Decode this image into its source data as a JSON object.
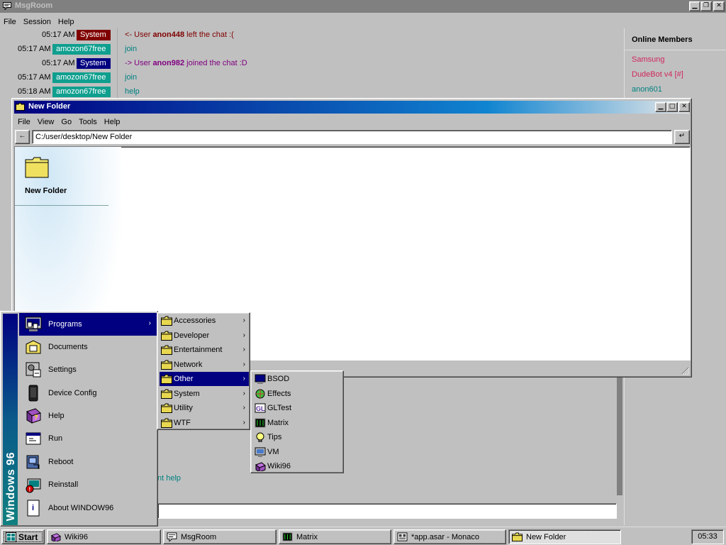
{
  "colors": {
    "accent": "#000080",
    "system_badge_red": "#800000",
    "system_badge_navy": "#000080",
    "user_badge": "#0f9f8f",
    "chat_text_teal": "#008080",
    "leave_text": "#800000",
    "join_text": "#800080"
  },
  "msgroom": {
    "title": "MsgRoom",
    "menu": [
      "File",
      "Session",
      "Help"
    ],
    "messages": [
      {
        "time": "05:17 AM",
        "user": "System",
        "badge_color": "#800000",
        "text_prefix": "<- User ",
        "text_bold": "anon448",
        "text_suffix": " left the chat :(",
        "text_color": "#800000"
      },
      {
        "time": "05:17 AM",
        "user": "amozon67free",
        "badge_color": "#0f9f8f",
        "text_prefix": "join",
        "text_bold": "",
        "text_suffix": "",
        "text_color": "#008080"
      },
      {
        "time": "05:17 AM",
        "user": "System",
        "badge_color": "#000080",
        "text_prefix": "-> User ",
        "text_bold": "anon982",
        "text_suffix": " joined the chat :D",
        "text_color": "#800080"
      },
      {
        "time": "05:17 AM",
        "user": "amozon67free",
        "badge_color": "#0f9f8f",
        "text_prefix": "join",
        "text_bold": "",
        "text_suffix": "",
        "text_color": "#008080"
      },
      {
        "time": "05:18 AM",
        "user": "amozon67free",
        "badge_color": "#0f9f8f",
        "text_prefix": "help",
        "text_bold": "",
        "text_suffix": "",
        "text_color": "#008080"
      }
    ],
    "online": {
      "title": "Online Members",
      "members": [
        {
          "name": "Samsung",
          "color": "#d0285c"
        },
        {
          "name": "DudeBot v4 [#]",
          "color": "#d0285c"
        },
        {
          "name": "anon601",
          "color": "#008080"
        }
      ]
    },
    "partial_help_text": "nt help",
    "input_value": ""
  },
  "explorer": {
    "title": "New Folder",
    "menu": [
      "File",
      "View",
      "Go",
      "Tools",
      "Help"
    ],
    "back_glyph": "←",
    "address": "C:/user/desktop/New Folder",
    "go_glyph": "↵",
    "sidebar_title": "New Folder"
  },
  "start_menu": {
    "banner": "Windows 96",
    "items": [
      {
        "label": "Programs",
        "icon": "programs-icon",
        "has_arrow": true,
        "active": true
      },
      {
        "label": "Documents",
        "icon": "documents-icon",
        "has_arrow": false
      },
      {
        "label": "Settings",
        "icon": "settings-icon",
        "has_arrow": false
      },
      {
        "label": "Device Config",
        "icon": "device-config-icon",
        "has_arrow": false
      },
      {
        "label": "Help",
        "icon": "help-book-icon",
        "has_arrow": false
      },
      {
        "label": "Run",
        "icon": "run-icon",
        "has_arrow": false
      },
      {
        "label": "Reboot",
        "icon": "reboot-icon",
        "has_arrow": false
      },
      {
        "label": "Reinstall",
        "icon": "reinstall-icon",
        "has_arrow": false
      },
      {
        "label": "About WINDOW96",
        "icon": "about-icon",
        "has_arrow": false
      }
    ],
    "arrow_glyph": "›"
  },
  "programs_submenu": {
    "items": [
      {
        "label": "Accessories",
        "active": false
      },
      {
        "label": "Developer",
        "active": false
      },
      {
        "label": "Entertainment",
        "active": false
      },
      {
        "label": "Network",
        "active": false
      },
      {
        "label": "Other",
        "active": true
      },
      {
        "label": "System",
        "active": false
      },
      {
        "label": "Utility",
        "active": false
      },
      {
        "label": "WTF",
        "active": false
      }
    ]
  },
  "other_submenu": {
    "items": [
      {
        "label": "BSOD",
        "icon": "bsod-icon"
      },
      {
        "label": "Effects",
        "icon": "effects-icon"
      },
      {
        "label": "GLTest",
        "icon": "gltest-icon"
      },
      {
        "label": "Matrix",
        "icon": "matrix-icon"
      },
      {
        "label": "Tips",
        "icon": "tips-icon"
      },
      {
        "label": "VM",
        "icon": "vm-icon"
      },
      {
        "label": "Wiki96",
        "icon": "wiki96-icon"
      }
    ]
  },
  "taskbar": {
    "start_label": "Start",
    "tasks": [
      {
        "label": "Wiki96",
        "icon": "wiki96-icon",
        "pressed": false
      },
      {
        "label": "MsgRoom",
        "icon": "msgroom-icon",
        "pressed": false
      },
      {
        "label": "Matrix",
        "icon": "matrix-icon",
        "pressed": false
      },
      {
        "label": "*app.asar - Monaco",
        "icon": "monaco-icon",
        "pressed": false
      },
      {
        "label": "New Folder",
        "icon": "folder-icon",
        "pressed": true
      }
    ],
    "clock": "05:33"
  }
}
